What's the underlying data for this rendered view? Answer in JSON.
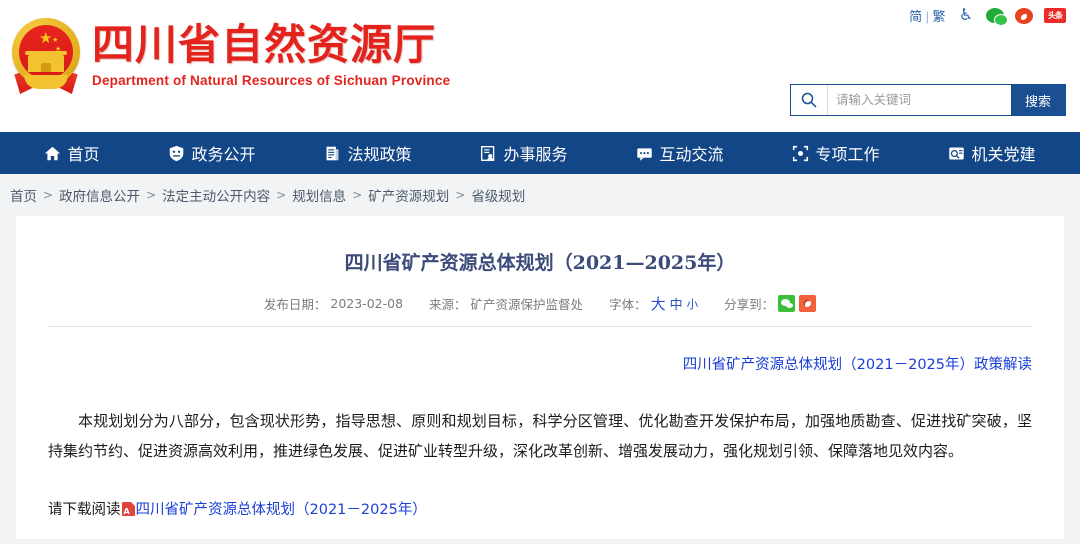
{
  "header": {
    "site_title_cn": "四川省自然资源厅",
    "site_title_en": "Department of Natural Resources of Sichuan Province",
    "emblem_name": "national-emblem",
    "utilities": {
      "lang_simplified": "简",
      "lang_divider": "|",
      "lang_traditional": "繁",
      "accessibility_icon": "accessibility-icon",
      "wechat_icon": "wechat-icon",
      "weibo_icon": "weibo-icon",
      "toutiao_icon": "toutiao-icon",
      "toutiao_label": "头条"
    },
    "search": {
      "icon": "search-icon",
      "placeholder": "请输入关键词",
      "value": "",
      "button_label": "搜索"
    }
  },
  "nav": {
    "items": [
      {
        "label": "首页",
        "icon": "home-icon"
      },
      {
        "label": "政务公开",
        "icon": "shield-icon"
      },
      {
        "label": "法规政策",
        "icon": "document-icon"
      },
      {
        "label": "办事服务",
        "icon": "service-form-icon"
      },
      {
        "label": "互动交流",
        "icon": "chat-bubble-icon"
      },
      {
        "label": "专项工作",
        "icon": "target-focus-icon"
      },
      {
        "label": "机关党建",
        "icon": "party-badge-icon"
      }
    ]
  },
  "breadcrumb": {
    "separator": ">",
    "items": [
      "首页",
      "政府信息公开",
      "法定主动公开内容",
      "规划信息",
      "矿产资源规划",
      "省级规划"
    ]
  },
  "article": {
    "title": "四川省矿产资源总体规划（2021—2025年）",
    "meta": {
      "publish_label": "发布日期：",
      "publish_date": "2023-02-08",
      "source_label": "来源：",
      "source_value": "矿产资源保护监督处",
      "fontsize_label": "字体：",
      "fontsize_large": "大",
      "fontsize_medium": "中",
      "fontsize_small": "小",
      "share_label": "分享到：",
      "share_wechat_icon": "wechat-share-icon",
      "share_weibo_icon": "weibo-share-icon"
    },
    "interpretation_link": "四川省矿产资源总体规划（2021－2025年）政策解读",
    "paragraph": "本规划划分为八部分，包含现状形势，指导思想、原则和规划目标，科学分区管理、优化勘查开发保护布局，加强地质勘查、促进找矿突破，坚持集约节约、促进资源高效利用，推进绿色发展、促进矿业转型升级，深化改革创新、增强发展动力，强化规划引领、保障落地见效内容。",
    "download_prefix": "请下载阅读",
    "download_icon": "pdf-file-icon",
    "download_link": "四川省矿产资源总体规划（2021－2025年）"
  },
  "colors": {
    "brand_red": "#e3231c",
    "nav_blue": "#124687",
    "link_blue": "#1a3fd6",
    "band_gray": "#f2f3f5",
    "title_blue": "#3c4b7a"
  }
}
